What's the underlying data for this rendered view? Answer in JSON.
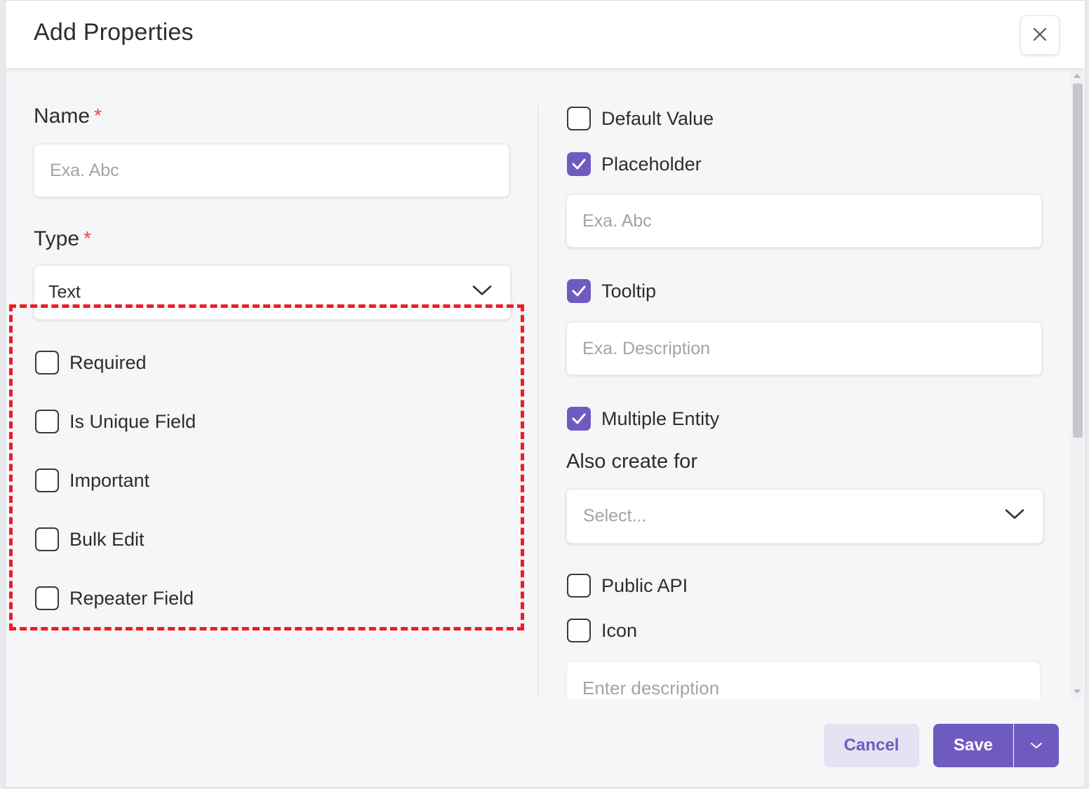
{
  "modal": {
    "title": "Add Properties"
  },
  "left": {
    "name_label": "Name",
    "name_placeholder": "Exa. Abc",
    "type_label": "Type",
    "required_mark": "*",
    "type_value": "Text",
    "options": [
      {
        "label": "Required",
        "checked": false
      },
      {
        "label": "Is Unique Field",
        "checked": false
      },
      {
        "label": "Important",
        "checked": false
      },
      {
        "label": "Bulk Edit",
        "checked": false
      },
      {
        "label": "Repeater Field",
        "checked": false
      }
    ]
  },
  "right": {
    "default_value": {
      "label": "Default Value",
      "checked": false
    },
    "placeholder": {
      "label": "Placeholder",
      "checked": true,
      "input_placeholder": "Exa. Abc"
    },
    "tooltip": {
      "label": "Tooltip",
      "checked": true,
      "input_placeholder": "Exa. Description"
    },
    "multiple_entity": {
      "label": "Multiple Entity",
      "checked": true
    },
    "also_create_for": {
      "label": "Also create for",
      "placeholder": "Select..."
    },
    "public_api": {
      "label": "Public API",
      "checked": false
    },
    "icon": {
      "label": "Icon",
      "checked": false
    },
    "description_placeholder": "Enter description"
  },
  "footer": {
    "cancel_label": "Cancel",
    "save_label": "Save"
  },
  "colors": {
    "accent": "#6f5bbf",
    "cancel_bg": "#e4e2f3",
    "required_star": "#e5484d",
    "highlight_dashed": "#ee1c25"
  },
  "icons": {
    "close": "close-icon",
    "chevron": "chevron-down-icon",
    "check": "check-icon"
  }
}
